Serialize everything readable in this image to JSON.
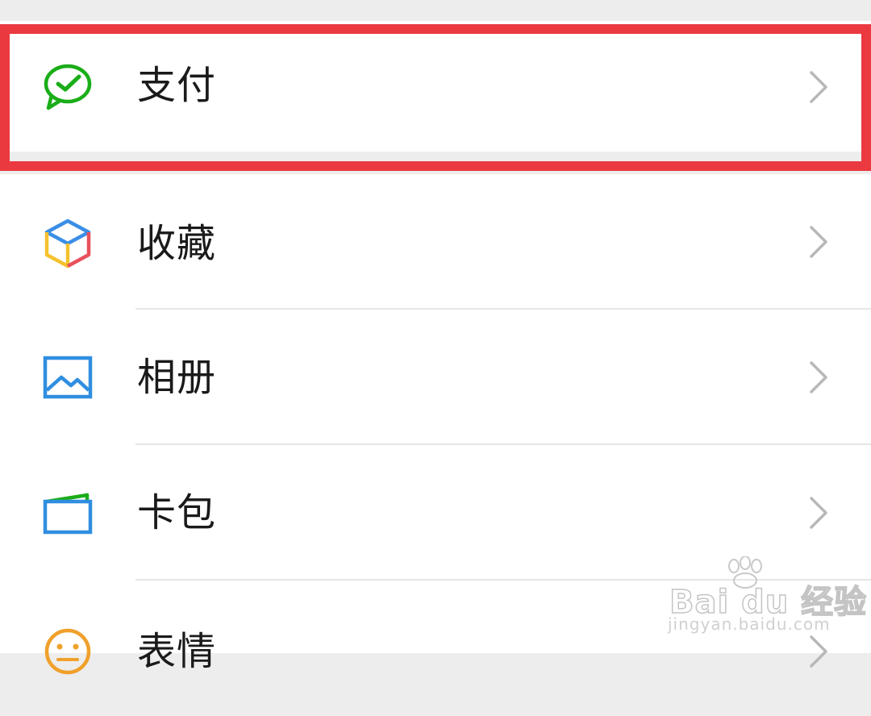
{
  "menu": {
    "pay": {
      "label": "支付",
      "icon": "wechat-pay-icon",
      "color": "#1aad19"
    },
    "items": [
      {
        "label": "收藏",
        "icon": "favorites-cube-icon"
      },
      {
        "label": "相册",
        "icon": "album-icon"
      },
      {
        "label": "卡包",
        "icon": "card-wallet-icon"
      },
      {
        "label": "表情",
        "icon": "emoji-icon"
      }
    ]
  },
  "annotation": {
    "highlight_color": "#ea3a40"
  },
  "watermark": {
    "brand": "Bai du 经验",
    "url": "jingyan.baidu.com"
  }
}
